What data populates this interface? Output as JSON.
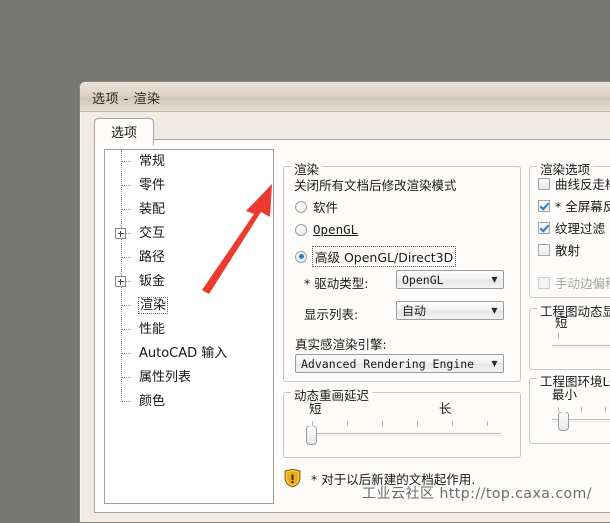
{
  "window": {
    "title": "选项 - 渲染",
    "tab_label": "选项"
  },
  "sidebar": {
    "items": [
      {
        "label": "常规",
        "expandable": false,
        "selected": false
      },
      {
        "label": "零件",
        "expandable": false,
        "selected": false
      },
      {
        "label": "装配",
        "expandable": false,
        "selected": false
      },
      {
        "label": "交互",
        "expandable": true,
        "selected": false
      },
      {
        "label": "路径",
        "expandable": false,
        "selected": false
      },
      {
        "label": "钣金",
        "expandable": true,
        "selected": false
      },
      {
        "label": "渲染",
        "expandable": false,
        "selected": true
      },
      {
        "label": "性能",
        "expandable": false,
        "selected": false
      },
      {
        "label": "AutoCAD 输入",
        "expandable": false,
        "selected": false
      },
      {
        "label": "属性列表",
        "expandable": false,
        "selected": false
      },
      {
        "label": "颜色",
        "expandable": false,
        "selected": false
      }
    ]
  },
  "render_group": {
    "title": "渲染",
    "hint": "关闭所有文档后修改渲染模式",
    "radios": [
      {
        "label": "软件",
        "checked": false,
        "focused": false,
        "mono": false
      },
      {
        "label": "OpenGL",
        "checked": false,
        "focused": false,
        "mono": true
      },
      {
        "label": "高级 OpenGL/Direct3D",
        "checked": true,
        "focused": true,
        "mono": false
      }
    ],
    "driver_type_label": "* 驱动类型:",
    "driver_type_value": "OpenGL",
    "display_list_label": "显示列表:",
    "display_list_value": "自动",
    "realistic_engine_label": "真实感渲染引擎:",
    "realistic_engine_value": "Advanced Rendering Engine"
  },
  "redraw_group": {
    "title": "动态重画延迟",
    "min_label": "短",
    "max_label": "长",
    "value_percent": 0,
    "tick_count": 6
  },
  "render_options_group": {
    "title": "渲染选项",
    "checkboxes": [
      {
        "label": "曲线反走样",
        "checked": false,
        "disabled": false
      },
      {
        "label": "* 全屏幕反走样",
        "checked": true,
        "disabled": false
      },
      {
        "label": "纹理过滤",
        "checked": true,
        "disabled": false
      },
      {
        "label": "散射",
        "checked": false,
        "disabled": false
      },
      {
        "label": "手动边偏移量",
        "checked": false,
        "disabled": true
      }
    ]
  },
  "dynamic_display_group": {
    "title": "工程图动态显示延迟",
    "min_label": "短",
    "value_percent": 78,
    "tick_count": 3
  },
  "lod_group": {
    "title": "工程图环境LOD（",
    "min_label": "最小",
    "value_percent": 4,
    "tick_count": 7
  },
  "footer": {
    "icon": "warning-shield-icon",
    "note": "* 对于以后新建的文档起作用."
  },
  "watermark": {
    "text": "工业云社区 http://top.caxa.com/"
  },
  "annotation": {
    "arrow_color": "#ed3a2f",
    "points_to": "软件"
  },
  "colors": {
    "desktop": "#777776",
    "dialog_face": "#fdfcfa",
    "accent_blue": "#1b7fd4"
  }
}
